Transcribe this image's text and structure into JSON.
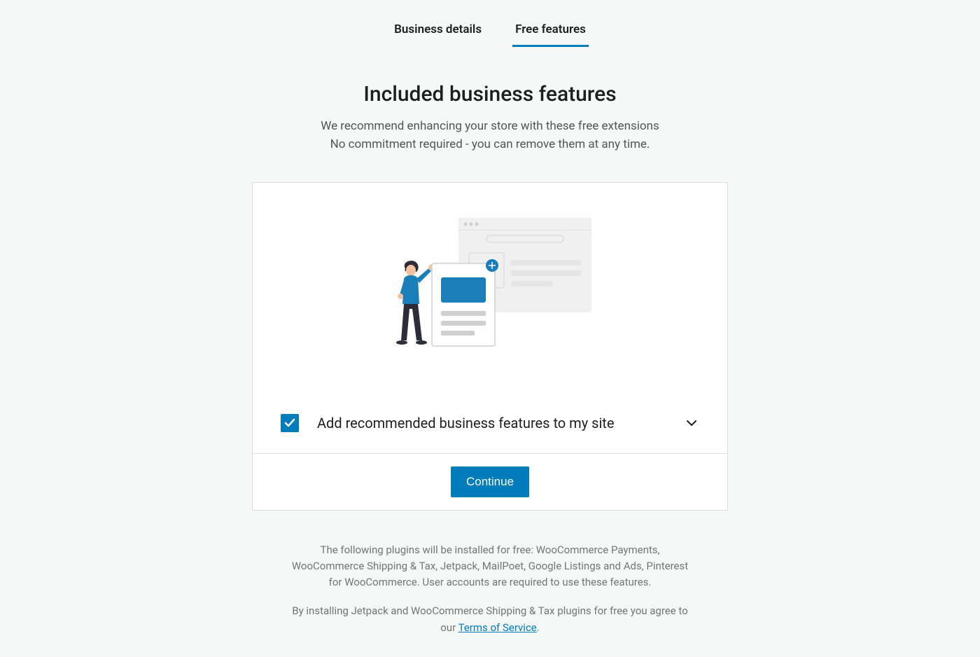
{
  "tabs": {
    "business_details": "Business details",
    "free_features": "Free features"
  },
  "header": {
    "title": "Included business features",
    "subtitle_line1": "We recommend enhancing your store with these free extensions",
    "subtitle_line2": "No commitment required - you can remove them at any time."
  },
  "checkbox": {
    "label": "Add recommended business features to my site",
    "checked": true
  },
  "button": {
    "continue": "Continue"
  },
  "footer": {
    "plugins_text": "The following plugins will be installed for free: WooCommerce Payments, WooCommerce Shipping & Tax, Jetpack, MailPoet, Google Listings and Ads, Pinterest for WooCommerce. User accounts are required to use these features.",
    "terms_prefix": "By installing Jetpack and WooCommerce Shipping & Tax plugins for free you agree to our ",
    "terms_link": "Terms of Service",
    "terms_suffix": "."
  }
}
